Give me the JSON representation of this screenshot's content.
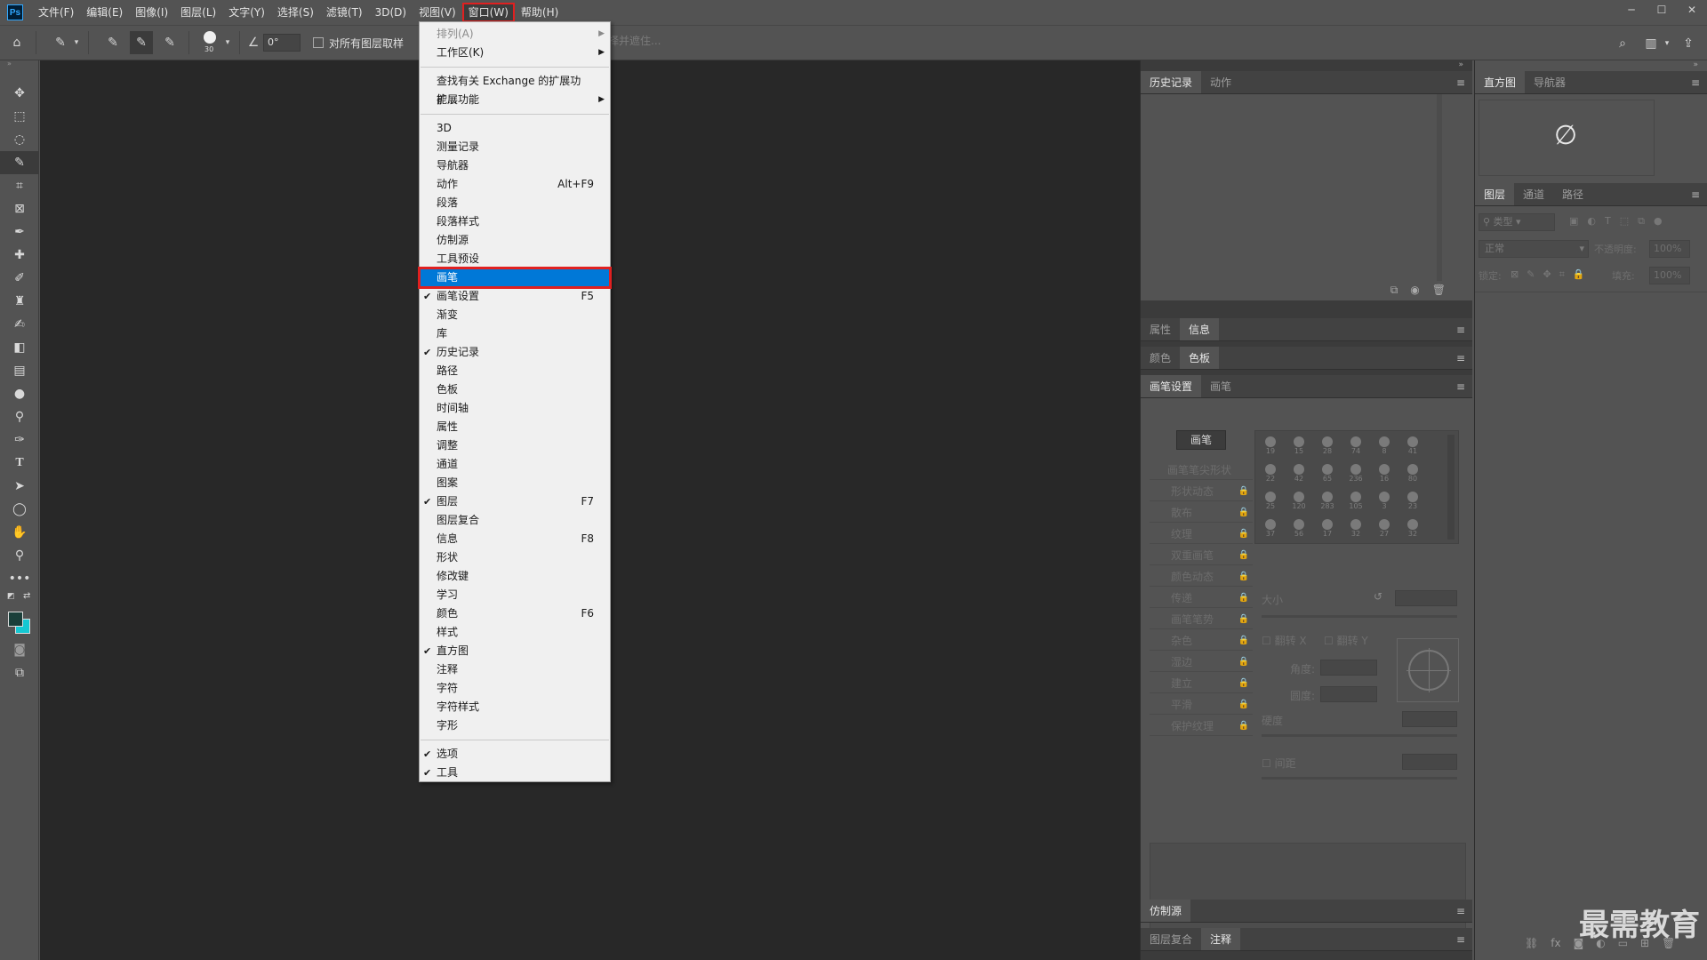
{
  "app": {
    "logo": "Ps"
  },
  "menubar": {
    "items": [
      "文件(F)",
      "编辑(E)",
      "图像(I)",
      "图层(L)",
      "文字(Y)",
      "选择(S)",
      "滤镜(T)",
      "3D(D)",
      "视图(V)",
      "窗口(W)",
      "帮助(H)"
    ],
    "active": "窗口(W)"
  },
  "options_bar": {
    "brush_size": "30",
    "angle_value": "0°",
    "sample_all_layers_label": "对所有图层取样",
    "ghost_text": "择并遮住..."
  },
  "window_menu": {
    "arrange": "排列(A)",
    "workspace": "工作区(K)",
    "exchange": "查找有关 Exchange 的扩展功能...",
    "extensions": "扩展功能",
    "items": [
      {
        "label": "3D"
      },
      {
        "label": "测量记录"
      },
      {
        "label": "导航器"
      },
      {
        "label": "动作",
        "shortcut": "Alt+F9"
      },
      {
        "label": "段落"
      },
      {
        "label": "段落样式"
      },
      {
        "label": "仿制源"
      },
      {
        "label": "工具预设"
      },
      {
        "label": "画笔",
        "highlighted": true
      },
      {
        "label": "画笔设置",
        "checked": true,
        "shortcut": "F5"
      },
      {
        "label": "渐变"
      },
      {
        "label": "库"
      },
      {
        "label": "历史记录",
        "checked": true
      },
      {
        "label": "路径"
      },
      {
        "label": "色板"
      },
      {
        "label": "时间轴"
      },
      {
        "label": "属性"
      },
      {
        "label": "调整"
      },
      {
        "label": "通道"
      },
      {
        "label": "图案"
      },
      {
        "label": "图层",
        "checked": true,
        "shortcut": "F7"
      },
      {
        "label": "图层复合"
      },
      {
        "label": "信息",
        "shortcut": "F8"
      },
      {
        "label": "形状"
      },
      {
        "label": "修改键"
      },
      {
        "label": "学习"
      },
      {
        "label": "颜色",
        "shortcut": "F6"
      },
      {
        "label": "样式"
      },
      {
        "label": "直方图",
        "checked": true
      },
      {
        "label": "注释"
      },
      {
        "label": "字符"
      },
      {
        "label": "字符样式"
      },
      {
        "label": "字形"
      }
    ],
    "bottom_items": [
      {
        "label": "选项",
        "checked": true
      },
      {
        "label": "工具",
        "checked": true
      }
    ]
  },
  "panels": {
    "history_tabs": [
      "历史记录",
      "动作"
    ],
    "props_tabs": [
      "属性",
      "信息"
    ],
    "color_tabs": [
      "颜色",
      "色板"
    ],
    "brush_tabs": [
      "画笔设置",
      "画笔"
    ],
    "brush_button": "画笔",
    "brush_tip_shape": "画笔笔尖形状",
    "brush_options": [
      "形状动态",
      "散布",
      "纹理",
      "双重画笔",
      "颜色动态",
      "传递",
      "画笔笔势",
      "杂色",
      "湿边",
      "建立",
      "平滑",
      "保护纹理"
    ],
    "brush_size_label": "大小",
    "flip_x": "翻转 X",
    "flip_y": "翻转 Y",
    "angle_label": "角度:",
    "roundness_label": "圆度:",
    "hardness_label": "硬度",
    "spacing_label": "间距",
    "brush_sizes": [
      "19",
      "15",
      "28",
      "74",
      "8",
      "41",
      "22",
      "42",
      "65",
      "236",
      "16",
      "80",
      "25",
      "120",
      "283",
      "105",
      "3",
      "23",
      "37",
      "56",
      "17",
      "32",
      "27",
      "32"
    ],
    "clone_tabs": [
      "仿制源"
    ],
    "comp_tabs": [
      "图层复合",
      "注释"
    ],
    "histogram_tabs": [
      "直方图",
      "导航器"
    ],
    "histogram_symbol": "∅",
    "layers_tabs": [
      "图层",
      "通道",
      "路径"
    ],
    "layers_filter": "类型",
    "blend_mode": "正常",
    "opacity_label": "不透明度:",
    "opacity_value": "100%",
    "lock_label": "锁定:",
    "fill_label": "填充:",
    "fill_value": "100%"
  },
  "watermark": "最需教育"
}
